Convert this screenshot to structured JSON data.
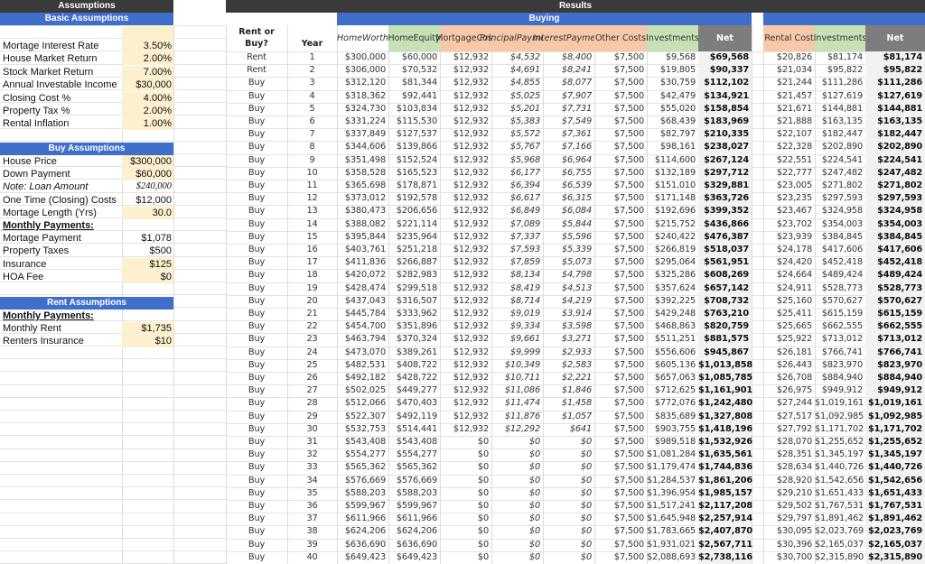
{
  "assumptions": {
    "title": "Assumptions",
    "basic": {
      "header": "Basic Assumptions",
      "items": [
        {
          "label": "Mortage Interest Rate",
          "value": "3.50%",
          "input": true
        },
        {
          "label": "House Market Return",
          "value": "2.00%",
          "input": true
        },
        {
          "label": "Stock Market Return",
          "value": "7.00%",
          "input": true
        },
        {
          "label": "Annual Investable Income",
          "value": "$30,000",
          "input": true
        },
        {
          "label": "Closing Cost %",
          "value": "4.00%",
          "input": true
        },
        {
          "label": "Property Tax %",
          "value": "2.00%",
          "input": true
        },
        {
          "label": "Rental Inflation",
          "value": "1.00%",
          "input": true
        }
      ]
    },
    "buy": {
      "header": "Buy Assumptions",
      "items": [
        {
          "label": "House Price",
          "value": "$300,000",
          "input": true
        },
        {
          "label": "Down Payment",
          "value": "$60,000",
          "input": true
        },
        {
          "label": "Note: Loan Amount",
          "value": "$240,000",
          "input": false,
          "italic": true
        },
        {
          "label": "One Time (Closing) Costs",
          "value": "$12,000",
          "input": false
        },
        {
          "label": "Mortage Length (Yrs)",
          "value": "30.0",
          "input": true
        },
        {
          "label": "Monthly Payments:",
          "value": "",
          "input": false,
          "heading": true
        },
        {
          "label": "Mortage Payment",
          "value": "$1,078",
          "input": false
        },
        {
          "label": "Property Taxes",
          "value": "$500",
          "input": false
        },
        {
          "label": "Insurance",
          "value": "$125",
          "input": true
        },
        {
          "label": "HOA Fee",
          "value": "$0",
          "input": true
        }
      ]
    },
    "rent": {
      "header": "Rent Assumptions",
      "items": [
        {
          "label": "Monthly Payments:",
          "value": "",
          "input": false,
          "heading": true
        },
        {
          "label": "Monthly Rent",
          "value": "$1,735",
          "input": true
        },
        {
          "label": "Renters Insurance",
          "value": "$10",
          "input": true
        }
      ]
    }
  },
  "results": {
    "title": "Results",
    "buying_header": "Buying",
    "columns": {
      "rent_or_buy": "Rent or Buy?",
      "year": "Year",
      "home_worth": "Home Worth",
      "home_equity": "Home Equity",
      "mortgage_cost": "Mortgage Cost",
      "principal": "Principal Payment",
      "interest": "Interest Payment",
      "other_costs": "Other Costs",
      "investments": "Investments",
      "net": "Net",
      "rental_cost": "Rental Cost",
      "rent_investments": "Investments",
      "rent_net": "Net"
    },
    "rows": [
      [
        "Rent",
        "1",
        "$300,000",
        "$60,000",
        "$12,932",
        "$4,532",
        "$8,400",
        "$7,500",
        "$9,568",
        "$69,568",
        "$20,826",
        "$81,174",
        "$81,174"
      ],
      [
        "Rent",
        "2",
        "$306,000",
        "$70,532",
        "$12,932",
        "$4,691",
        "$8,241",
        "$7,500",
        "$19,805",
        "$90,337",
        "$21,034",
        "$95,822",
        "$95,822"
      ],
      [
        "Buy",
        "3",
        "$312,120",
        "$81,344",
        "$12,932",
        "$4,855",
        "$8,077",
        "$7,500",
        "$30,759",
        "$112,102",
        "$21,244",
        "$111,286",
        "$111,286"
      ],
      [
        "Buy",
        "4",
        "$318,362",
        "$92,441",
        "$12,932",
        "$5,025",
        "$7,907",
        "$7,500",
        "$42,479",
        "$134,921",
        "$21,457",
        "$127,619",
        "$127,619"
      ],
      [
        "Buy",
        "5",
        "$324,730",
        "$103,834",
        "$12,932",
        "$5,201",
        "$7,731",
        "$7,500",
        "$55,020",
        "$158,854",
        "$21,671",
        "$144,881",
        "$144,881"
      ],
      [
        "Buy",
        "6",
        "$331,224",
        "$115,530",
        "$12,932",
        "$5,383",
        "$7,549",
        "$7,500",
        "$68,439",
        "$183,969",
        "$21,888",
        "$163,135",
        "$163,135"
      ],
      [
        "Buy",
        "7",
        "$337,849",
        "$127,537",
        "$12,932",
        "$5,572",
        "$7,361",
        "$7,500",
        "$82,797",
        "$210,335",
        "$22,107",
        "$182,447",
        "$182,447"
      ],
      [
        "Buy",
        "8",
        "$344,606",
        "$139,866",
        "$12,932",
        "$5,767",
        "$7,166",
        "$7,500",
        "$98,161",
        "$238,027",
        "$22,328",
        "$202,890",
        "$202,890"
      ],
      [
        "Buy",
        "9",
        "$351,498",
        "$152,524",
        "$12,932",
        "$5,968",
        "$6,964",
        "$7,500",
        "$114,600",
        "$267,124",
        "$22,551",
        "$224,541",
        "$224,541"
      ],
      [
        "Buy",
        "10",
        "$358,528",
        "$165,523",
        "$12,932",
        "$6,177",
        "$6,755",
        "$7,500",
        "$132,189",
        "$297,712",
        "$22,777",
        "$247,482",
        "$247,482"
      ],
      [
        "Buy",
        "11",
        "$365,698",
        "$178,871",
        "$12,932",
        "$6,394",
        "$6,539",
        "$7,500",
        "$151,010",
        "$329,881",
        "$23,005",
        "$271,802",
        "$271,802"
      ],
      [
        "Buy",
        "12",
        "$373,012",
        "$192,578",
        "$12,932",
        "$6,617",
        "$6,315",
        "$7,500",
        "$171,148",
        "$363,726",
        "$23,235",
        "$297,593",
        "$297,593"
      ],
      [
        "Buy",
        "13",
        "$380,473",
        "$206,656",
        "$12,932",
        "$6,849",
        "$6,084",
        "$7,500",
        "$192,696",
        "$399,352",
        "$23,467",
        "$324,958",
        "$324,958"
      ],
      [
        "Buy",
        "14",
        "$388,082",
        "$221,114",
        "$12,932",
        "$7,089",
        "$5,844",
        "$7,500",
        "$215,752",
        "$436,866",
        "$23,702",
        "$354,003",
        "$354,003"
      ],
      [
        "Buy",
        "15",
        "$395,844",
        "$235,964",
        "$12,932",
        "$7,337",
        "$5,596",
        "$7,500",
        "$240,422",
        "$476,387",
        "$23,939",
        "$384,845",
        "$384,845"
      ],
      [
        "Buy",
        "16",
        "$403,761",
        "$251,218",
        "$12,932",
        "$7,593",
        "$5,339",
        "$7,500",
        "$266,819",
        "$518,037",
        "$24,178",
        "$417,606",
        "$417,606"
      ],
      [
        "Buy",
        "17",
        "$411,836",
        "$266,887",
        "$12,932",
        "$7,859",
        "$5,073",
        "$7,500",
        "$295,064",
        "$561,951",
        "$24,420",
        "$452,418",
        "$452,418"
      ],
      [
        "Buy",
        "18",
        "$420,072",
        "$282,983",
        "$12,932",
        "$8,134",
        "$4,798",
        "$7,500",
        "$325,286",
        "$608,269",
        "$24,664",
        "$489,424",
        "$489,424"
      ],
      [
        "Buy",
        "19",
        "$428,474",
        "$299,518",
        "$12,932",
        "$8,419",
        "$4,513",
        "$7,500",
        "$357,624",
        "$657,142",
        "$24,911",
        "$528,773",
        "$528,773"
      ],
      [
        "Buy",
        "20",
        "$437,043",
        "$316,507",
        "$12,932",
        "$8,714",
        "$4,219",
        "$7,500",
        "$392,225",
        "$708,732",
        "$25,160",
        "$570,627",
        "$570,627"
      ],
      [
        "Buy",
        "21",
        "$445,784",
        "$333,962",
        "$12,932",
        "$9,019",
        "$3,914",
        "$7,500",
        "$429,248",
        "$763,210",
        "$25,411",
        "$615,159",
        "$615,159"
      ],
      [
        "Buy",
        "22",
        "$454,700",
        "$351,896",
        "$12,932",
        "$9,334",
        "$3,598",
        "$7,500",
        "$468,863",
        "$820,759",
        "$25,665",
        "$662,555",
        "$662,555"
      ],
      [
        "Buy",
        "23",
        "$463,794",
        "$370,324",
        "$12,932",
        "$9,661",
        "$3,271",
        "$7,500",
        "$511,251",
        "$881,575",
        "$25,922",
        "$713,012",
        "$713,012"
      ],
      [
        "Buy",
        "24",
        "$473,070",
        "$389,261",
        "$12,932",
        "$9,999",
        "$2,933",
        "$7,500",
        "$556,606",
        "$945,867",
        "$26,181",
        "$766,741",
        "$766,741"
      ],
      [
        "Buy",
        "25",
        "$482,531",
        "$408,722",
        "$12,932",
        "$10,349",
        "$2,583",
        "$7,500",
        "$605,136",
        "$1,013,858",
        "$26,443",
        "$823,970",
        "$823,970"
      ],
      [
        "Buy",
        "26",
        "$492,182",
        "$428,722",
        "$12,932",
        "$10,711",
        "$2,221",
        "$7,500",
        "$657,063",
        "$1,085,785",
        "$26,708",
        "$884,940",
        "$884,940"
      ],
      [
        "Buy",
        "27",
        "$502,025",
        "$449,277",
        "$12,932",
        "$11,086",
        "$1,846",
        "$7,500",
        "$712,625",
        "$1,161,901",
        "$26,975",
        "$949,912",
        "$949,912"
      ],
      [
        "Buy",
        "28",
        "$512,066",
        "$470,403",
        "$12,932",
        "$11,474",
        "$1,458",
        "$7,500",
        "$772,076",
        "$1,242,480",
        "$27,244",
        "$1,019,161",
        "$1,019,161"
      ],
      [
        "Buy",
        "29",
        "$522,307",
        "$492,119",
        "$12,932",
        "$11,876",
        "$1,057",
        "$7,500",
        "$835,689",
        "$1,327,808",
        "$27,517",
        "$1,092,985",
        "$1,092,985"
      ],
      [
        "Buy",
        "30",
        "$532,753",
        "$514,441",
        "$12,932",
        "$12,292",
        "$641",
        "$7,500",
        "$903,755",
        "$1,418,196",
        "$27,792",
        "$1,171,702",
        "$1,171,702"
      ],
      [
        "Buy",
        "31",
        "$543,408",
        "$543,408",
        "$0",
        "$0",
        "$0",
        "$7,500",
        "$989,518",
        "$1,532,926",
        "$28,070",
        "$1,255,652",
        "$1,255,652"
      ],
      [
        "Buy",
        "32",
        "$554,277",
        "$554,277",
        "$0",
        "$0",
        "$0",
        "$7,500",
        "$1,081,284",
        "$1,635,561",
        "$28,351",
        "$1,345,197",
        "$1,345,197"
      ],
      [
        "Buy",
        "33",
        "$565,362",
        "$565,362",
        "$0",
        "$0",
        "$0",
        "$7,500",
        "$1,179,474",
        "$1,744,836",
        "$28,634",
        "$1,440,726",
        "$1,440,726"
      ],
      [
        "Buy",
        "34",
        "$576,669",
        "$576,669",
        "$0",
        "$0",
        "$0",
        "$7,500",
        "$1,284,537",
        "$1,861,206",
        "$28,920",
        "$1,542,656",
        "$1,542,656"
      ],
      [
        "Buy",
        "35",
        "$588,203",
        "$588,203",
        "$0",
        "$0",
        "$0",
        "$7,500",
        "$1,396,954",
        "$1,985,157",
        "$29,210",
        "$1,651,433",
        "$1,651,433"
      ],
      [
        "Buy",
        "36",
        "$599,967",
        "$599,967",
        "$0",
        "$0",
        "$0",
        "$7,500",
        "$1,517,241",
        "$2,117,208",
        "$29,502",
        "$1,767,531",
        "$1,767,531"
      ],
      [
        "Buy",
        "37",
        "$611,966",
        "$611,966",
        "$0",
        "$0",
        "$0",
        "$7,500",
        "$1,645,948",
        "$2,257,914",
        "$29,797",
        "$1,891,462",
        "$1,891,462"
      ],
      [
        "Buy",
        "38",
        "$624,206",
        "$624,206",
        "$0",
        "$0",
        "$0",
        "$7,500",
        "$1,783,665",
        "$2,407,870",
        "$30,095",
        "$2,023,769",
        "$2,023,769"
      ],
      [
        "Buy",
        "39",
        "$636,690",
        "$636,690",
        "$0",
        "$0",
        "$0",
        "$7,500",
        "$1,931,021",
        "$2,567,711",
        "$30,396",
        "$2,165,037",
        "$2,165,037"
      ],
      [
        "Buy",
        "40",
        "$649,423",
        "$649,423",
        "$0",
        "$0",
        "$0",
        "$7,500",
        "$2,088,693",
        "$2,738,116",
        "$30,700",
        "$2,315,890",
        "$2,315,890"
      ]
    ]
  },
  "colors": {
    "dark_header": "#3a3a3a",
    "blue_header": "#3f6fcb",
    "input_cell": "#fdf0cf",
    "green_header": "#c6e2b5",
    "orange_header": "#f8c9a9",
    "net_header": "#7d7d7d"
  }
}
